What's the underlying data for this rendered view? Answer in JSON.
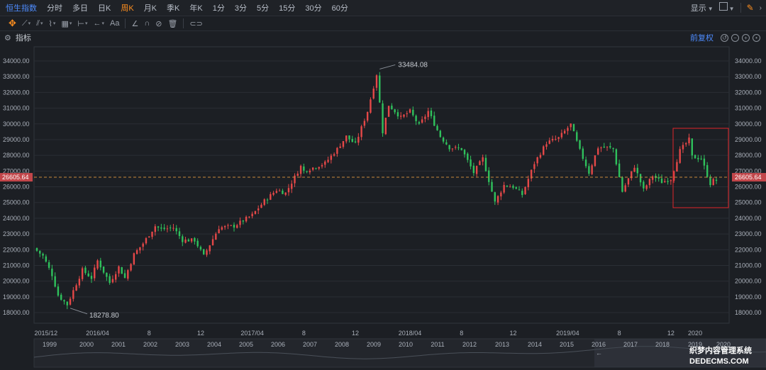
{
  "header": {
    "tabs": [
      "恒生指数",
      "分时",
      "多日",
      "日K",
      "周K",
      "月K",
      "季K",
      "年K",
      "1分",
      "3分",
      "5分",
      "15分",
      "30分",
      "60分"
    ],
    "active_tab": "周K",
    "display_label": "显示"
  },
  "toolbar": {
    "tools": [
      "move-icon",
      "line-draw-icon",
      "channel-draw-icon",
      "wave-draw-icon",
      "fib-draw-icon",
      "measure-draw-icon",
      "arrow-draw-icon",
      "text-draw-icon",
      "angle-icon",
      "magnet-icon",
      "hide-icon",
      "trash-icon",
      "link-icon"
    ],
    "text_tool_label": "Aa"
  },
  "indicator_bar": {
    "label": "指标",
    "adjust_label": "前复权"
  },
  "colors": {
    "up": "#e54848",
    "down": "#2fc15c",
    "accent": "#ff8f1f",
    "brand": "#4e8cff",
    "current_price_line": "#c98a3c"
  },
  "chart_data": {
    "type": "candlestick",
    "title": "恒生指数",
    "period": "周K",
    "ylim": [
      17300,
      34800
    ],
    "yticks": [
      "34000.00",
      "33000.00",
      "32000.00",
      "31000.00",
      "30000.00",
      "29000.00",
      "28000.00",
      "27000.00",
      "26000.00",
      "25000.00",
      "24000.00",
      "23000.00",
      "22000.00",
      "21000.00",
      "20000.00",
      "19000.00",
      "18000.00"
    ],
    "xticks": [
      "2015/12",
      "2016/04",
      "8",
      "12",
      "2017/04",
      "8",
      "12",
      "2018/04",
      "8",
      "12",
      "2019/04",
      "8",
      "12",
      "2020"
    ],
    "current_price": 26605.64,
    "current_price_label": "26605.64",
    "max_label": "33484.08",
    "min_label": "18278.80",
    "anchors": [
      [
        "2015-11-27",
        22100
      ],
      [
        "2015-12-18",
        21600
      ],
      [
        "2016-01-08",
        20400
      ],
      [
        "2016-01-22",
        19100
      ],
      [
        "2016-02-12",
        18500
      ],
      [
        "2016-02-26",
        19400
      ],
      [
        "2016-03-18",
        20700
      ],
      [
        "2016-04-08",
        20200
      ],
      [
        "2016-04-22",
        21300
      ],
      [
        "2016-05-20",
        19900
      ],
      [
        "2016-06-10",
        20900
      ],
      [
        "2016-06-24",
        20200
      ],
      [
        "2016-07-15",
        21700
      ],
      [
        "2016-08-05",
        22400
      ],
      [
        "2016-09-02",
        23500
      ],
      [
        "2016-09-16",
        23300
      ],
      [
        "2016-10-14",
        23400
      ],
      [
        "2016-11-04",
        22600
      ],
      [
        "2016-12-02",
        22600
      ],
      [
        "2016-12-23",
        21600
      ],
      [
        "2017-01-27",
        23400
      ],
      [
        "2017-03-03",
        23500
      ],
      [
        "2017-04-14",
        24200
      ],
      [
        "2017-05-12",
        25100
      ],
      [
        "2017-06-09",
        25800
      ],
      [
        "2017-06-30",
        25600
      ],
      [
        "2017-08-04",
        27300
      ],
      [
        "2017-08-11",
        27000
      ],
      [
        "2017-09-29",
        27500
      ],
      [
        "2017-10-27",
        28400
      ],
      [
        "2017-11-17",
        29200
      ],
      [
        "2017-12-08",
        28700
      ],
      [
        "2018-01-05",
        30800
      ],
      [
        "2018-01-26",
        33154
      ],
      [
        "2018-02-09",
        29500
      ],
      [
        "2018-02-23",
        31200
      ],
      [
        "2018-03-23",
        30400
      ],
      [
        "2018-04-13",
        30800
      ],
      [
        "2018-05-04",
        29900
      ],
      [
        "2018-05-25",
        30800
      ],
      [
        "2018-06-22",
        29200
      ],
      [
        "2018-07-13",
        28500
      ],
      [
        "2018-08-10",
        28400
      ],
      [
        "2018-09-07",
        26900
      ],
      [
        "2018-09-28",
        27800
      ],
      [
        "2018-10-26",
        25000
      ],
      [
        "2018-11-16",
        26100
      ],
      [
        "2018-12-07",
        26000
      ],
      [
        "2018-12-28",
        25500
      ],
      [
        "2019-01-25",
        27500
      ],
      [
        "2019-02-22",
        28800
      ],
      [
        "2019-03-22",
        29100
      ],
      [
        "2019-04-19",
        29960
      ],
      [
        "2019-05-10",
        28300
      ],
      [
        "2019-05-31",
        26900
      ],
      [
        "2019-06-21",
        28500
      ],
      [
        "2019-07-12",
        28500
      ],
      [
        "2019-07-26",
        28400
      ],
      [
        "2019-08-16",
        25700
      ],
      [
        "2019-09-13",
        27300
      ],
      [
        "2019-10-04",
        25800
      ],
      [
        "2019-10-25",
        26700
      ],
      [
        "2019-11-15",
        26300
      ],
      [
        "2019-12-06",
        26500
      ],
      [
        "2019-12-27",
        28300
      ],
      [
        "2020-01-17",
        29000
      ],
      [
        "2020-01-24",
        27900
      ],
      [
        "2020-02-14",
        27800
      ],
      [
        "2020-03-06",
        26200
      ],
      [
        "2020-03-13",
        26400
      ]
    ]
  },
  "navigator": {
    "years": [
      "1999",
      "2000",
      "2001",
      "2002",
      "2003",
      "2004",
      "2005",
      "2006",
      "2007",
      "2008",
      "2009",
      "2010",
      "2011",
      "2012",
      "2013",
      "2014",
      "2015",
      "2016",
      "2017",
      "2018",
      "2019",
      "2020"
    ],
    "handle_label": "←"
  },
  "watermark": {
    "line1": "织梦内容管理系统",
    "line2": "DEDECMS.COM"
  }
}
